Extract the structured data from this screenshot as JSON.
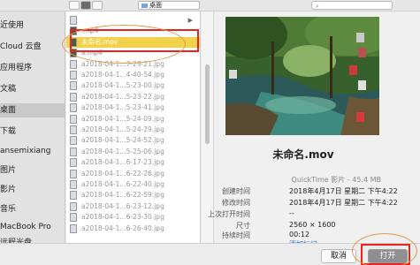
{
  "toolbar": {
    "location": "桌面"
  },
  "sidebar": {
    "items": [
      {
        "label": "近使用",
        "selected": false
      },
      {
        "label": "Cloud 云盘",
        "selected": false
      },
      {
        "label": "应用程序",
        "selected": false
      },
      {
        "label": "文稿",
        "selected": false
      },
      {
        "label": "桌面",
        "selected": true
      },
      {
        "label": "下载",
        "selected": false
      },
      {
        "label": "ansemixiang",
        "selected": false
      },
      {
        "label": "图片",
        "selected": false
      },
      {
        "label": "影片",
        "selected": false
      },
      {
        "label": "音乐",
        "selected": false
      },
      {
        "label": "MacBook Pro",
        "selected": false
      },
      {
        "label": "远程光盘",
        "selected": false
      }
    ]
  },
  "files": [
    {
      "name": "",
      "kind": "folder",
      "state": "blurred"
    },
    {
      "name": ".mp4",
      "kind": "video",
      "state": "blurred"
    },
    {
      "name": "未命名.mov",
      "kind": "video",
      "state": "selected"
    },
    {
      "name": "a.mp4",
      "kind": "video",
      "state": "blurred"
    },
    {
      "name": "a2018-04-1...7-29-21.jpg",
      "kind": "image",
      "state": ""
    },
    {
      "name": "a2018-04-1...4-40-54.jpg",
      "kind": "image",
      "state": ""
    },
    {
      "name": "a2018-04-1...5-23-00.jpg",
      "kind": "image",
      "state": ""
    },
    {
      "name": "a2018-04-1...5-23-22.jpg",
      "kind": "image",
      "state": ""
    },
    {
      "name": "a2018-04-1...5-23-41.jpg",
      "kind": "image",
      "state": ""
    },
    {
      "name": "a2018-04-1...5-24-09.jpg",
      "kind": "image",
      "state": ""
    },
    {
      "name": "a2018-04-1...5-24-29.jpg",
      "kind": "image",
      "state": ""
    },
    {
      "name": "a2018-04-1...5-24-52.jpg",
      "kind": "image",
      "state": ""
    },
    {
      "name": "a2018-04-1...5-25-06.jpg",
      "kind": "image",
      "state": ""
    },
    {
      "name": "a2018-04-1...6-17-23.jpg",
      "kind": "image",
      "state": ""
    },
    {
      "name": "a2018-04-1...6-22-26.jpg",
      "kind": "image",
      "state": ""
    },
    {
      "name": "a2018-04-1...6-22-40.jpg",
      "kind": "image",
      "state": ""
    },
    {
      "name": "a2018-04-1...6-22-59.jpg",
      "kind": "image",
      "state": ""
    },
    {
      "name": "a2018-04-1...6-23-12.jpg",
      "kind": "image",
      "state": ""
    },
    {
      "name": "a2018-04-1...6-23-30.jpg",
      "kind": "image",
      "state": ""
    },
    {
      "name": "a2018-04-1...6-26-40.jpg",
      "kind": "image",
      "state": ""
    }
  ],
  "preview": {
    "filename": "未命名.mov",
    "subtitle": "QuickTime 影片 - 45.4 MB",
    "info": [
      {
        "label": "创建时间",
        "value": "2018年4月17日 星期二 下午4:22"
      },
      {
        "label": "修改时间",
        "value": "2018年4月17日 星期二 下午4:22"
      },
      {
        "label": "上次打开时间",
        "value": "--"
      },
      {
        "label": "尺寸",
        "value": "2560 × 1600"
      },
      {
        "label": "持续时间",
        "value": "00:12"
      }
    ],
    "add_tags": "添加标记..."
  },
  "buttons": {
    "cancel": "取消",
    "open": "打开"
  },
  "colors": {
    "selection": "#f2d24a",
    "annotation_box": "#e8241c",
    "annotation_ring": "#e39a4a",
    "link": "#2b6fd6"
  }
}
